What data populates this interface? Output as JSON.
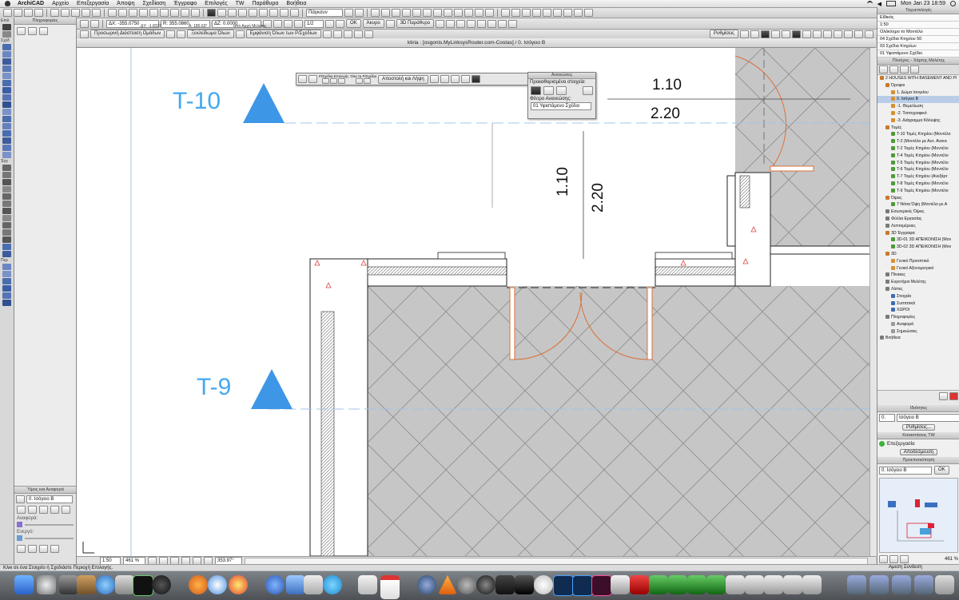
{
  "menubar": {
    "app": "ArchiCAD",
    "items": [
      "Αρχείο",
      "Επεξεργασία",
      "Άποψη",
      "Σχεδίαση",
      "Έγγραφο",
      "Επιλογές",
      "TW",
      "Παράθυρα",
      "Βοήθεια"
    ],
    "clock": "Mon Jan 23  18:59"
  },
  "toolbar": {
    "view_dropdown": "Πάγκσυν",
    "coords": {
      "dx": "ΔX: -355.0750",
      "dy": "ΔY: -1.8327",
      "r": "R: 355.0860",
      "a": "A: 180.63°",
      "dz": "ΔZ: 0.0000",
      "ref": "από Αρχή Μελέτης"
    },
    "ok_label": "OK",
    "cancel_label": "Άκυρο",
    "window_3d": "3D Παράθυρο",
    "settings_btn": "Ρυθμίσεις",
    "group_label": "Προσωρινή Διάσπαση Ομάδων",
    "unlock_all": "Ξεκλείδωμα Όλων",
    "show_all": "Εμφάνιση Όλων των Ρ/Σχεδίων",
    "fraction": "1/2"
  },
  "infopanel": {
    "title": "Πληροφορίες",
    "select_label": "Επιλ",
    "design_label": "Σχέδ",
    "doc_label": "Έγγ",
    "more_label": "Περ",
    "story_title": "Ύψος και Αναφορά",
    "story_value": "0. Ισόγειο Β",
    "ref_label": "Αναφορά:",
    "active_label": "Ενεργό:"
  },
  "window_title": "ktiria : [osgonis.MyLinksysRouter.com-Costas] / 0. Ισόγειο Β",
  "drawing": {
    "label_t10": "T-10",
    "label_t9": "T-9",
    "dim_h1": "1.10",
    "dim_h2": "2.20",
    "dim_v1": "1.10",
    "dim_v2": "2.20"
  },
  "floating_toolbar": {
    "group1": "Ρ/Σχέδια Επιλογής",
    "group2": "Όλα τα Ρ/Σχέδια",
    "action": "Αποστολή και Λήψη"
  },
  "reserve_palette": {
    "title": "Ανανεώσεις",
    "reserved_label": "Προκαθορισμένα στοιχεία:",
    "filter_label": "Φίλτρο Ανανεώσης:",
    "filter_value": "01 Υφιστάμενο Σχέδιο"
  },
  "canvas_bar": {
    "scale": "1:50",
    "zoom": "461 %",
    "angle": "353.97°"
  },
  "statusbar": "Κλικ σε ένα Στοιχείο ή Σχεδιάστε Περιοχή Επιλογής.",
  "navigator": {
    "title": "Ταχυεπιλογές",
    "sub1": "Είδικός",
    "scale": "1:50",
    "layer_combo": "Ολόκληρο το Μοντέλο",
    "presets": [
      "04 Σχέδια Κτηρίου 50",
      "03 Σχέδια Κτηρίων",
      "01 Υφιστάμενο Σχέδιο"
    ],
    "map_title": "Πλοήγος - Χάρτης Μελέτης",
    "tree": [
      {
        "lvl": 0,
        "t": "2 HOUSES WITH BASEMENT AND PI",
        "c": "#c9792c"
      },
      {
        "lvl": 1,
        "t": "Όροφοι",
        "c": "#c9792c"
      },
      {
        "lvl": 2,
        "t": "1. Δώμα Ισογείου",
        "c": "#d9902f"
      },
      {
        "lvl": 2,
        "t": "0. Ισόγειο Β",
        "c": "#d9902f",
        "sel": true
      },
      {
        "lvl": 2,
        "t": "-1. Θεμελίωση",
        "c": "#d9902f"
      },
      {
        "lvl": 2,
        "t": "-2. Τοπογραφικό",
        "c": "#d9902f"
      },
      {
        "lvl": 2,
        "t": "-3. Διάγραμμα Κάλυψης",
        "c": "#d9902f"
      },
      {
        "lvl": 1,
        "t": "Τομές",
        "c": "#c9792c"
      },
      {
        "lvl": 2,
        "t": "T-10 Τομές Κτηρίου (Μοντέλο",
        "c": "#4f9a3a"
      },
      {
        "lvl": 2,
        "t": "T-2 (Μοντέλο με Αυτ. Ανανε",
        "c": "#4f9a3a"
      },
      {
        "lvl": 2,
        "t": "T-2 Τομές Κτηρίου (Μοντέλο",
        "c": "#4f9a3a"
      },
      {
        "lvl": 2,
        "t": "T-4 Τομές Κτηρίου (Μοντέλο",
        "c": "#4f9a3a"
      },
      {
        "lvl": 2,
        "t": "T-5 Τομές Κτηρίου (Μοντέλο",
        "c": "#4f9a3a"
      },
      {
        "lvl": 2,
        "t": "T-6 Τομές Κτηρίου (Μοντέλο",
        "c": "#4f9a3a"
      },
      {
        "lvl": 2,
        "t": "T-7 Τομές Κτηρίου (Ανεξάρτ",
        "c": "#4f9a3a"
      },
      {
        "lvl": 2,
        "t": "T-8 Τομές Κτηρίου (Μοντέλο",
        "c": "#4f9a3a"
      },
      {
        "lvl": 2,
        "t": "T-9 Τομές Κτηρίου (Μοντέλο",
        "c": "#4f9a3a"
      },
      {
        "lvl": 1,
        "t": "Όψεις",
        "c": "#c9792c"
      },
      {
        "lvl": 2,
        "t": "7 Νότια Όψη (Μοντέλο με Α",
        "c": "#4f9a3a"
      },
      {
        "lvl": 1,
        "t": "Εσωτερικές Όψεις",
        "c": "#7a7a7a"
      },
      {
        "lvl": 1,
        "t": "Φύλλα Εργασίας",
        "c": "#7a7a7a"
      },
      {
        "lvl": 1,
        "t": "Λεπτομέρειες",
        "c": "#7a7a7a"
      },
      {
        "lvl": 1,
        "t": "3D Έγγραφα",
        "c": "#c9792c"
      },
      {
        "lvl": 2,
        "t": "3D-01 3D ΑΠΕΙΚΟΝΙΣΗ (Μον",
        "c": "#4f9a3a"
      },
      {
        "lvl": 2,
        "t": "3D-02 3D ΑΠΕΙΚΟΝΙΣΗ (Μον",
        "c": "#4f9a3a"
      },
      {
        "lvl": 1,
        "t": "3D",
        "c": "#c9792c"
      },
      {
        "lvl": 2,
        "t": "Γενικό Προοπτικό",
        "c": "#d9902f"
      },
      {
        "lvl": 2,
        "t": "Γενικό Αξονομετρικό",
        "c": "#d9902f"
      },
      {
        "lvl": 1,
        "t": "Πίνακες",
        "c": "#7a7a7a"
      },
      {
        "lvl": 1,
        "t": "Ευρετήριο Μελέτης",
        "c": "#7a7a7a"
      },
      {
        "lvl": 1,
        "t": "Λίστες",
        "c": "#7a7a7a"
      },
      {
        "lvl": 2,
        "t": "Στοιχεία",
        "c": "#3d6bb3"
      },
      {
        "lvl": 2,
        "t": "Συστατικά",
        "c": "#3d6bb3"
      },
      {
        "lvl": 2,
        "t": "ΧΩΡΟΙ",
        "c": "#3d6bb3"
      },
      {
        "lvl": 1,
        "t": "Πληροφορίες",
        "c": "#7a7a7a"
      },
      {
        "lvl": 2,
        "t": "Αναφορά",
        "c": "#9a9a9a"
      },
      {
        "lvl": 2,
        "t": "Σημειώσεις",
        "c": "#9a9a9a"
      },
      {
        "lvl": 0,
        "t": "Βοήθεια",
        "c": "#7a7a7a"
      }
    ],
    "props_title": "Ιδιότητες",
    "props_story_num": "0.",
    "props_story": "Ισόγειο Β",
    "props_btn": "Ρυθμίσεις...",
    "tw_title": "Καταστάσεις TW",
    "tw_status": "Επεξεργασία",
    "tw_btn": "Αποδέσμευση",
    "preview_title": "Προεπισκόπηση",
    "preview_story": "0. Ισόγειο Β",
    "preview_ok": "OK",
    "preview_zoom": "461 %",
    "immediate": "Άμεση Σύνδεση"
  }
}
